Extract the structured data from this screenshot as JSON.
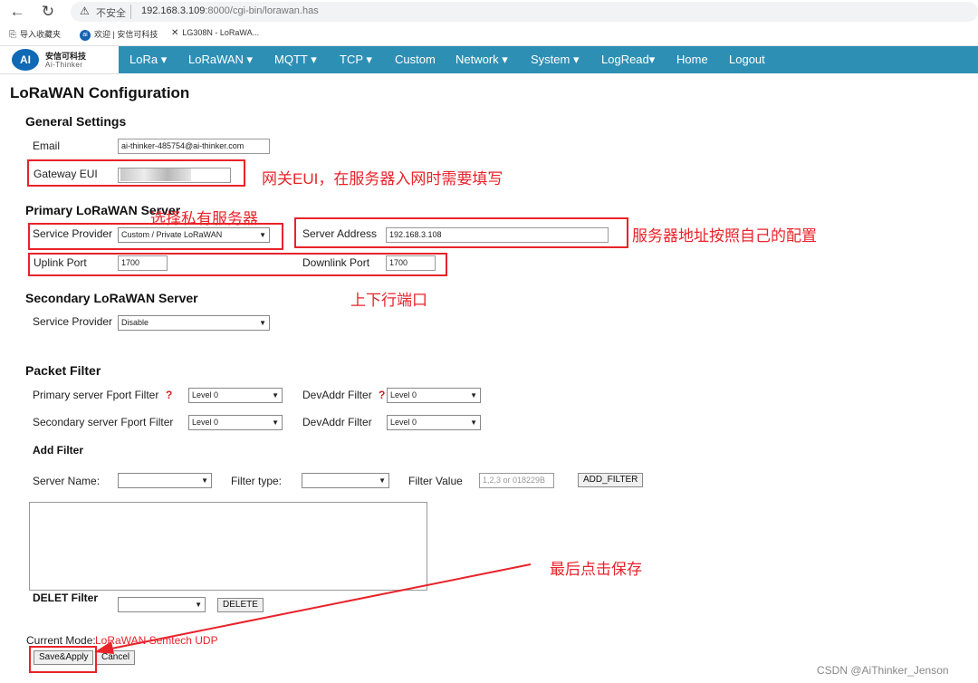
{
  "browser": {
    "security_label": "不安全",
    "url_host": "192.168.3.109",
    "url_rest": ":8000/cgi-bin/lorawan.has",
    "bookmarks": [
      "导入收藏夹",
      "欢迎 | 安信可科技",
      "LG308N - LoRaWA..."
    ]
  },
  "logo": {
    "title": "安信可科技",
    "subtitle": "Ai-Thinker",
    "mark": "AI"
  },
  "nav": {
    "lora": "LoRa ▾",
    "lorawan": "LoRaWAN ▾",
    "mqtt": "MQTT ▾",
    "tcp": "TCP ▾",
    "custom": "Custom",
    "network": "Network ▾",
    "system": "System ▾",
    "logread": "LogRead▾",
    "home": "Home",
    "logout": "Logout"
  },
  "page_title": "LoRaWAN Configuration",
  "general": {
    "heading": "General Settings",
    "email_label": "Email",
    "email_value": "ai-thinker-485754@ai-thinker.com",
    "eui_label": "Gateway EUI"
  },
  "primary": {
    "heading": "Primary LoRaWAN Server",
    "provider_label": "Service Provider",
    "provider_value": "Custom / Private LoRaWAN",
    "address_label": "Server Address",
    "address_value": "192.168.3.108",
    "uplink_label": "Uplink Port",
    "uplink_value": "1700",
    "downlink_label": "Downlink Port",
    "downlink_value": "1700"
  },
  "secondary": {
    "heading": "Secondary LoRaWAN Server",
    "provider_label": "Service Provider",
    "provider_value": "Disable"
  },
  "filter": {
    "heading": "Packet Filter",
    "primary_fport_label": "Primary server Fport Filter",
    "primary_fport_value": "Level 0",
    "devaddr_label": "DevAddr Filter",
    "devaddr1_value": "Level 0",
    "secondary_fport_label": "Secondary server Fport Filter",
    "secondary_fport_value": "Level 0",
    "devaddr2_value": "Level 0",
    "qmark": "?",
    "add_heading": "Add Filter",
    "server_name_label": "Server Name:",
    "filter_type_label": "Filter type:",
    "filter_value_label": "Filter Value",
    "filter_value_placeholder": "1,2,3 or 018229B",
    "add_button": "ADD_FILTER",
    "delet_heading": "DELET Filter",
    "delete_button": "DELETE"
  },
  "footer": {
    "mode_label": "Current Mode:",
    "mode_value": "LoRaWAN Semtech UDP",
    "save_button": "Save&Apply",
    "cancel_button": "Cancel"
  },
  "annotations": {
    "eui_note": "网关EUI，在服务器入网时需要填写",
    "provider_note": "选择私有服务器",
    "address_note": "服务器地址按照自己的配置",
    "ports_note": "上下行端口",
    "save_note": "最后点击保存"
  },
  "watermark": "CSDN @AiThinker_Jenson",
  "colors": {
    "nav_bg": "#2e8fb4",
    "annotation_red": "#e8232a",
    "mode_red": "#e8232a"
  }
}
